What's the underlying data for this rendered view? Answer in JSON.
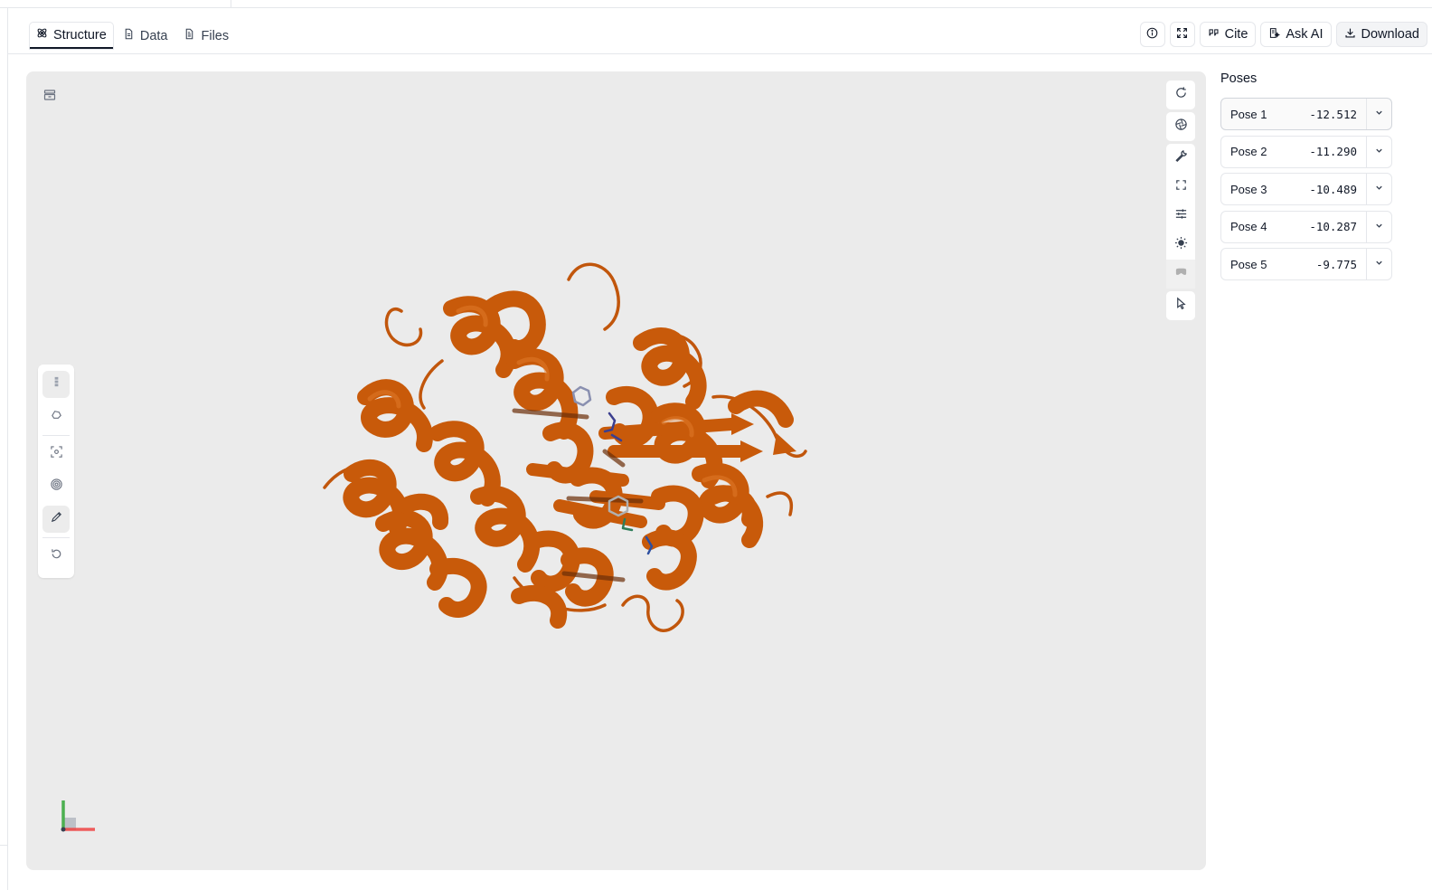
{
  "tabs": [
    {
      "label": "Structure",
      "icon": "atom-icon",
      "active": true
    },
    {
      "label": "Data",
      "icon": "document-icon",
      "active": false
    },
    {
      "label": "Files",
      "icon": "file-icon",
      "active": false
    }
  ],
  "actions": {
    "info_icon": "info-icon",
    "expand_icon": "expand-icon",
    "cite_label": "Cite",
    "ask_ai_label": "Ask AI",
    "download_label": "Download"
  },
  "viewer": {
    "protein_color": "#c85a0a",
    "background": "#ebebeb",
    "left_tools": [
      "select-icon",
      "lasso-icon",
      "focus-icon",
      "target-icon",
      "pen-icon",
      "reset-icon"
    ],
    "right_tools": [
      "rotate-icon",
      "aperture-icon",
      "wrench-icon",
      "fullscreen-icon",
      "sliders-icon",
      "sun-icon",
      "vr-icon",
      "pointer-icon"
    ]
  },
  "poses": {
    "title": "Poses",
    "items": [
      {
        "label": "Pose 1",
        "score": "-12.512"
      },
      {
        "label": "Pose 2",
        "score": "-11.290"
      },
      {
        "label": "Pose 3",
        "score": "-10.489"
      },
      {
        "label": "Pose 4",
        "score": "-10.287"
      },
      {
        "label": "Pose 5",
        "score": "-9.775"
      }
    ]
  }
}
